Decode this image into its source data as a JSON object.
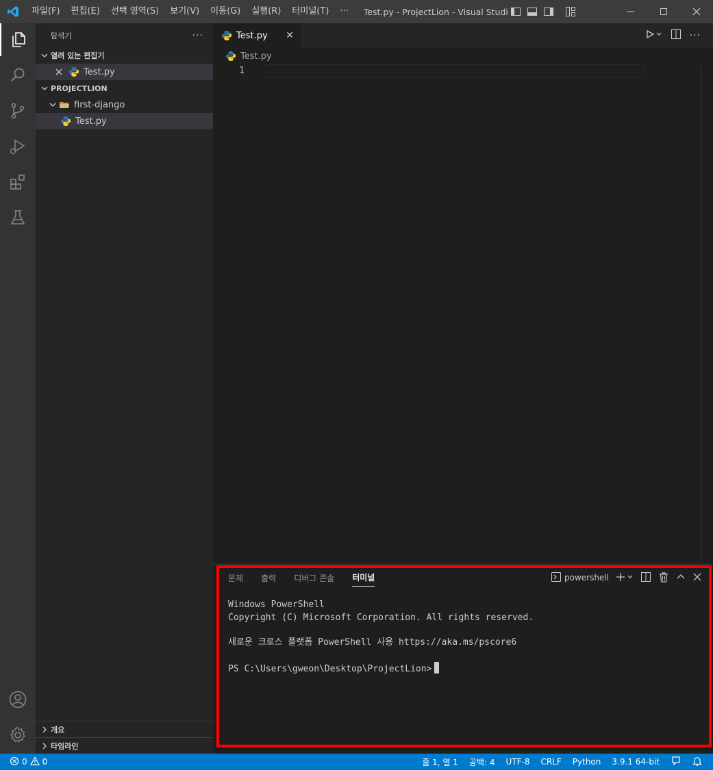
{
  "titlebar": {
    "menus": [
      "파일(F)",
      "편집(E)",
      "선택 영역(S)",
      "보기(V)",
      "이동(G)",
      "실행(R)",
      "터미널(T)",
      "···"
    ],
    "title": "Test.py - ProjectLion - Visual Studi..."
  },
  "sidebar": {
    "title": "탐색기",
    "more": "···",
    "open_editors": {
      "label": "열려 있는 편집기",
      "file": "Test.py"
    },
    "project": {
      "label": "PROJECTLION",
      "folder": "first-django",
      "file": "Test.py"
    },
    "outline": "개요",
    "timeline": "타임라인"
  },
  "editor": {
    "tab": {
      "label": "Test.py",
      "close": "✕"
    },
    "breadcrumb": "Test.py",
    "line_numbers": [
      "1"
    ]
  },
  "panel": {
    "tabs": [
      "문제",
      "출력",
      "디버그 콘솔",
      "터미널"
    ],
    "active_tab": "터미널",
    "shell": "powershell",
    "terminal": {
      "line1": "Windows PowerShell",
      "line2": "Copyright (C) Microsoft Corporation. All rights reserved.",
      "line3": "새로운 크로스 플랫폼 PowerShell 사용 https://aka.ms/pscore6",
      "prompt": "PS C:\\Users\\gweon\\Desktop\\ProjectLion>"
    }
  },
  "status": {
    "errors": "0",
    "warnings": "0",
    "position": "줄 1, 열 1",
    "spaces": "공백: 4",
    "encoding": "UTF-8",
    "eol": "CRLF",
    "language": "Python",
    "interpreter": "3.9.1 64-bit"
  },
  "colors": {
    "accent": "#007acc",
    "highlight": "#ff0000"
  }
}
